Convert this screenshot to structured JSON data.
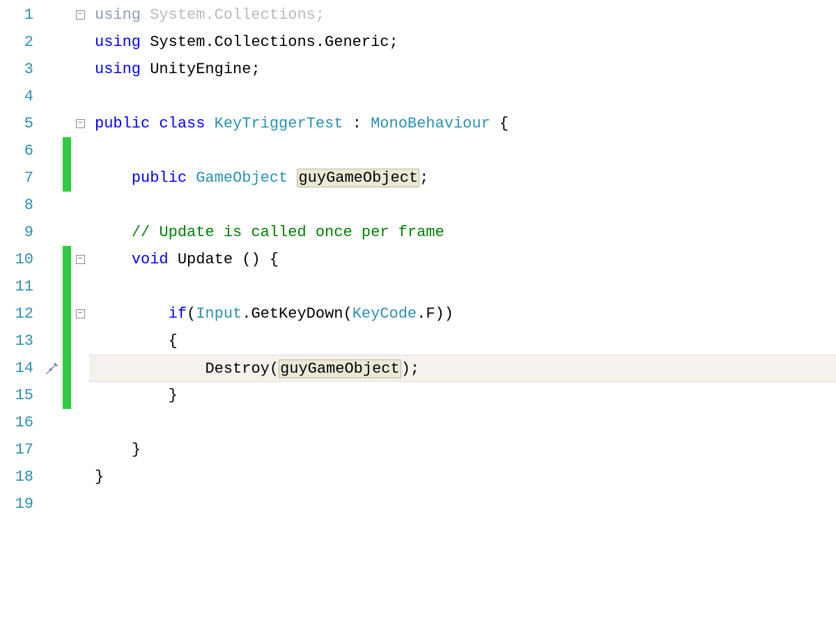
{
  "lines": {
    "numbers": [
      "1",
      "2",
      "3",
      "4",
      "5",
      "6",
      "7",
      "8",
      "9",
      "10",
      "11",
      "12",
      "13",
      "14",
      "15",
      "16",
      "17",
      "18",
      "19"
    ]
  },
  "code": {
    "l1": {
      "using": "using",
      "ns": "System.Collections",
      "semi": ";"
    },
    "l2": {
      "using": "using",
      "ns": "System.Collections.Generic",
      "semi": ";"
    },
    "l3": {
      "using": "using",
      "ns": "UnityEngine",
      "semi": ";"
    },
    "l5": {
      "pub": "public",
      "cls": "class",
      "name": "KeyTriggerTest",
      "colon": " : ",
      "base": "MonoBehaviour",
      "brace": " {"
    },
    "l7": {
      "pub": "public",
      "type": "GameObject",
      "var": "guyGameObject",
      "semi": ";"
    },
    "l9": {
      "comment": "// Update is called once per frame"
    },
    "l10": {
      "void": "void",
      "name": "Update ",
      "paren": "() {"
    },
    "l12": {
      "if": "if",
      "open": "(",
      "inp": "Input",
      "dot1": ".",
      "get": "GetKeyDown(",
      "kc": "KeyCode",
      "dot2": ".",
      "fclose": "F))"
    },
    "l13": {
      "brace": "{"
    },
    "l14": {
      "destroy": "Destroy(",
      "arg": "guyGameObject",
      "close": ");"
    },
    "l15": {
      "brace": "}"
    },
    "l17": {
      "brace": "}"
    },
    "l18": {
      "brace": "}"
    }
  },
  "fold": {
    "minus": "−"
  }
}
